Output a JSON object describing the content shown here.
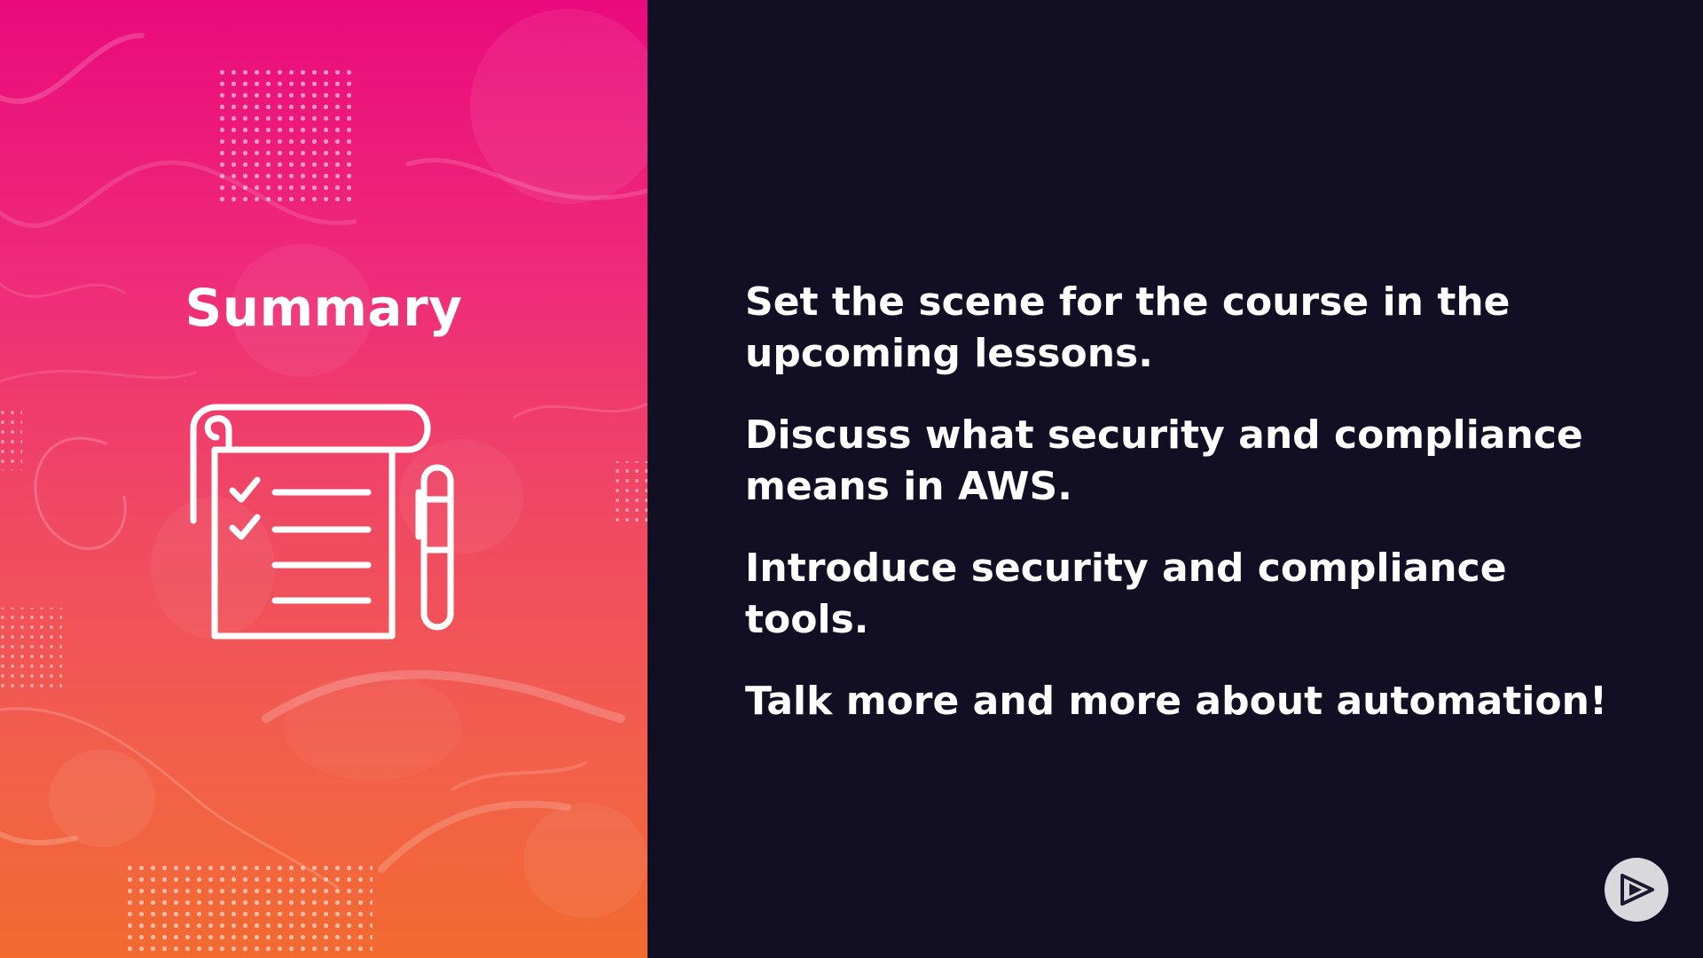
{
  "slide": {
    "title": "Summary",
    "bullets": [
      "Set the scene for the course in the upcoming lessons.",
      "Discuss what security and compliance means in AWS.",
      "Introduce security and compliance tools.",
      "Talk more and more about automation!"
    ]
  },
  "icons": {
    "checklist": "checklist-with-pen-icon",
    "logo": "play-logo-icon"
  },
  "colors": {
    "background_dark": "#120f24",
    "gradient_top": "#ea0a7c",
    "gradient_bottom": "#f26a30",
    "text": "#ffffff",
    "logo_bg": "#d9d9dd"
  }
}
